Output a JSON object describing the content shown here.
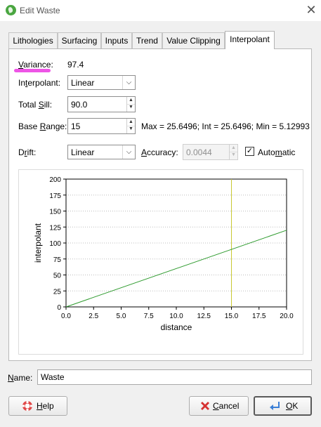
{
  "window": {
    "title": "Edit Waste",
    "icon": "leaf-app-icon",
    "close_glyph": "✕"
  },
  "tabs": [
    {
      "label": "Lithologies"
    },
    {
      "label": "Surfacing"
    },
    {
      "label": "Inputs"
    },
    {
      "label": "Trend"
    },
    {
      "label": "Value Clipping"
    },
    {
      "label": "Interpolant",
      "active": true
    }
  ],
  "form": {
    "variance": {
      "label": "Variance:",
      "value": "97.4"
    },
    "interpolant": {
      "label": "Interpolant:",
      "value": "Linear"
    },
    "total_sill": {
      "label": "Total Sill:",
      "value": "90.0"
    },
    "base_range": {
      "label": "Base Range:",
      "value": "15"
    },
    "range_info": "Max = 25.6496; Int = 25.6496; Min = 5.12993",
    "drift": {
      "label": "Drift:",
      "value": "Linear"
    },
    "accuracy": {
      "label": "Accuracy:",
      "value": "0.0044"
    },
    "automatic": {
      "label": "Automatic",
      "checked": true
    }
  },
  "chart_data": {
    "type": "line",
    "xlabel": "distance",
    "ylabel": "interpolant",
    "xlim": [
      0,
      20
    ],
    "ylim": [
      0,
      200
    ],
    "x_ticks": [
      "0.0",
      "2.5",
      "5.0",
      "7.5",
      "10.0",
      "12.5",
      "15.0",
      "17.5",
      "20.0"
    ],
    "y_ticks": [
      "0",
      "25",
      "50",
      "75",
      "100",
      "125",
      "150",
      "175",
      "200"
    ],
    "grid": "horizontal dotted",
    "series": [
      {
        "x": [
          0,
          20
        ],
        "y": [
          0,
          120
        ],
        "color": "#2e9b2e"
      }
    ],
    "vertical_marker": {
      "x": 15,
      "color": "#c8c832"
    }
  },
  "name": {
    "label": "Name:",
    "value": "Waste"
  },
  "buttons": {
    "help": "Help",
    "cancel": "Cancel",
    "ok": "OK"
  },
  "colors": {
    "highlight": "#ee55e6",
    "accent_green": "#2e9b2e",
    "marker_yellow": "#c8c832"
  }
}
